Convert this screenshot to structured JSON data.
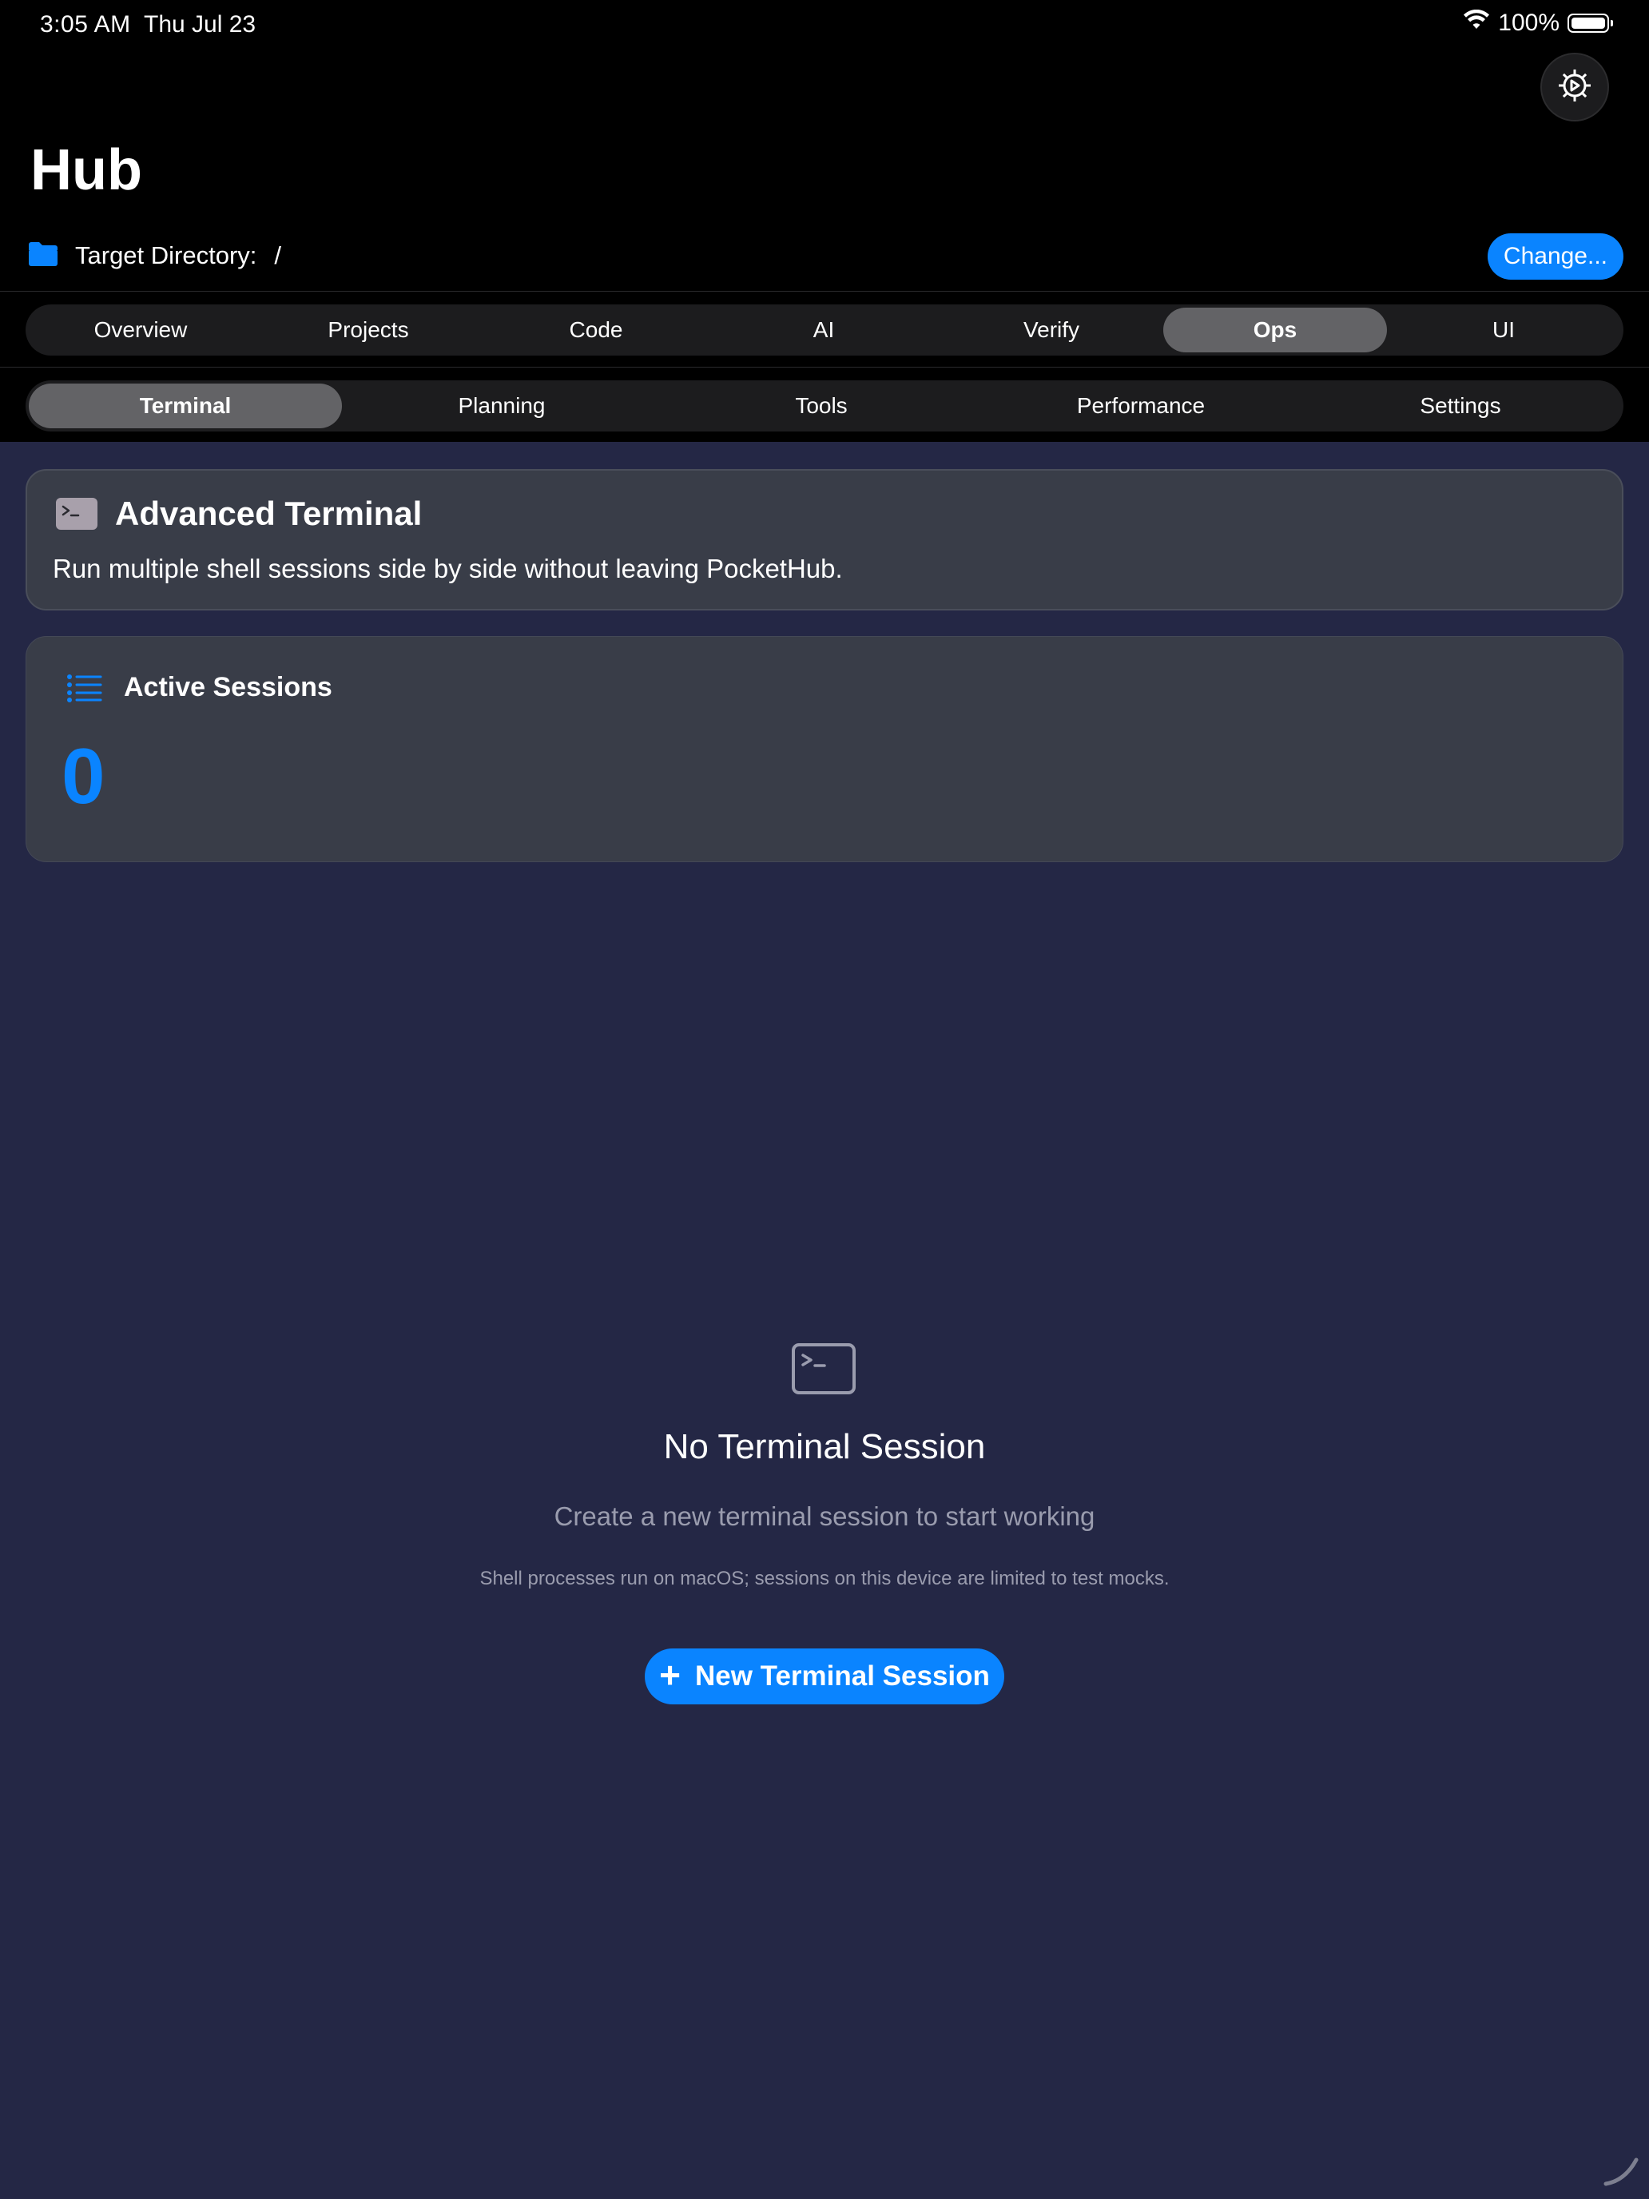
{
  "status": {
    "time": "3:05 AM",
    "date": "Thu Jul 23",
    "battery": "100%"
  },
  "header": {
    "title": "Hub",
    "target_label": "Target Directory:",
    "target_value": "/",
    "change_label": "Change..."
  },
  "main_tabs": {
    "items": [
      "Overview",
      "Projects",
      "Code",
      "AI",
      "Verify",
      "Ops",
      "UI"
    ],
    "selected": "Ops"
  },
  "sub_tabs": {
    "items": [
      "Terminal",
      "Planning",
      "Tools",
      "Performance",
      "Settings"
    ],
    "selected": "Terminal"
  },
  "advanced_card": {
    "title": "Advanced Terminal",
    "subtitle": "Run multiple shell sessions side by side without leaving PocketHub."
  },
  "sessions_card": {
    "title": "Active Sessions",
    "count": "0"
  },
  "empty_state": {
    "title": "No Terminal Session",
    "subtitle": "Create a new terminal session to start working",
    "note": "Shell processes run on macOS; sessions on this device are limited to test mocks.",
    "button_label": "New Terminal Session"
  },
  "icons": {
    "wifi": "wifi-icon",
    "battery": "battery-icon",
    "settings": "gear-icon",
    "folder": "folder-icon",
    "terminal": "terminal-icon",
    "list": "list-icon",
    "plus": "plus-icon"
  },
  "colors": {
    "accent": "#0a84ff",
    "background_top": "#000000",
    "content_background": "#242745",
    "card": "#393d48"
  }
}
